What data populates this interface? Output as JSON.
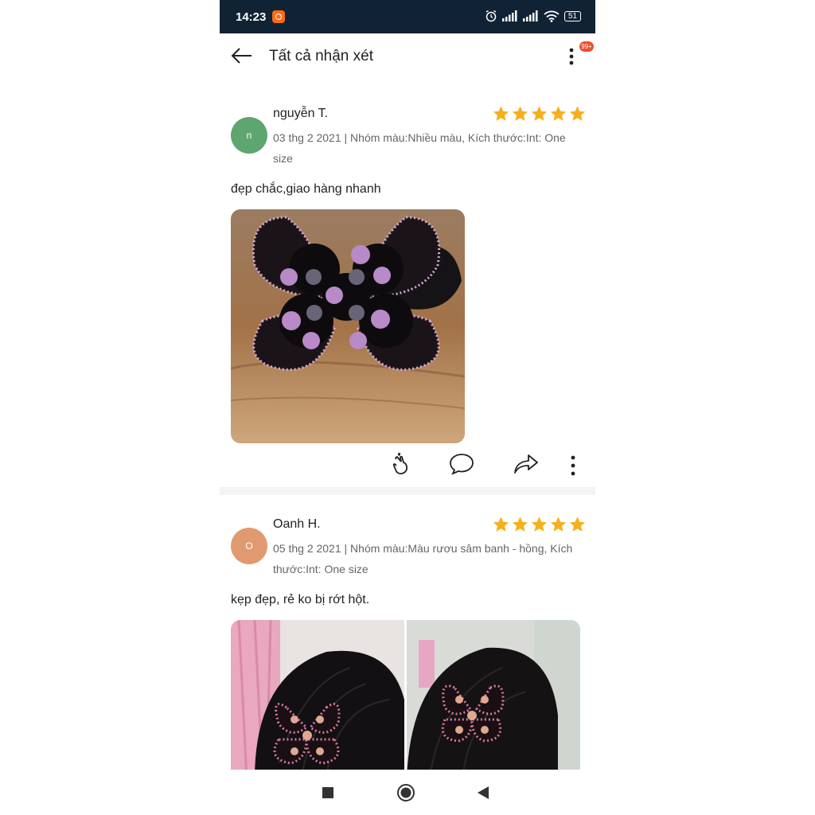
{
  "status_bar": {
    "time": "14:23",
    "battery": "51"
  },
  "header": {
    "title": "Tất cả nhận xét",
    "notification_badge": "99+"
  },
  "reviews": [
    {
      "avatar_letter": "n",
      "avatar_color": "#5fa572",
      "name": "nguyễn T.",
      "rating": 5,
      "meta": "03 thg 2 2021 | Nhóm màu:Nhiều màu, Kích thước:Int: One size",
      "text": "đẹp chắc,giao hàng nhanh",
      "photo_count": 1
    },
    {
      "avatar_letter": "O",
      "avatar_color": "#e19a6f",
      "name": "Oanh H.",
      "rating": 5,
      "meta": "05 thg 2 2021 | Nhóm màu:Màu rươu sâm banh - hồng, Kích thước:Int: One size",
      "text": "kẹp đẹp, rẻ ko bị rớt hột.",
      "photo_count": 2
    }
  ],
  "colors": {
    "star": "#f6b01c",
    "status_bar": "#102334",
    "badge": "#ee4d2d"
  },
  "icons": [
    "back-arrow-icon",
    "more-vert-icon",
    "finger-heart-icon",
    "comment-icon",
    "share-icon",
    "square-nav-icon",
    "home-circle-icon",
    "back-triangle-icon"
  ]
}
